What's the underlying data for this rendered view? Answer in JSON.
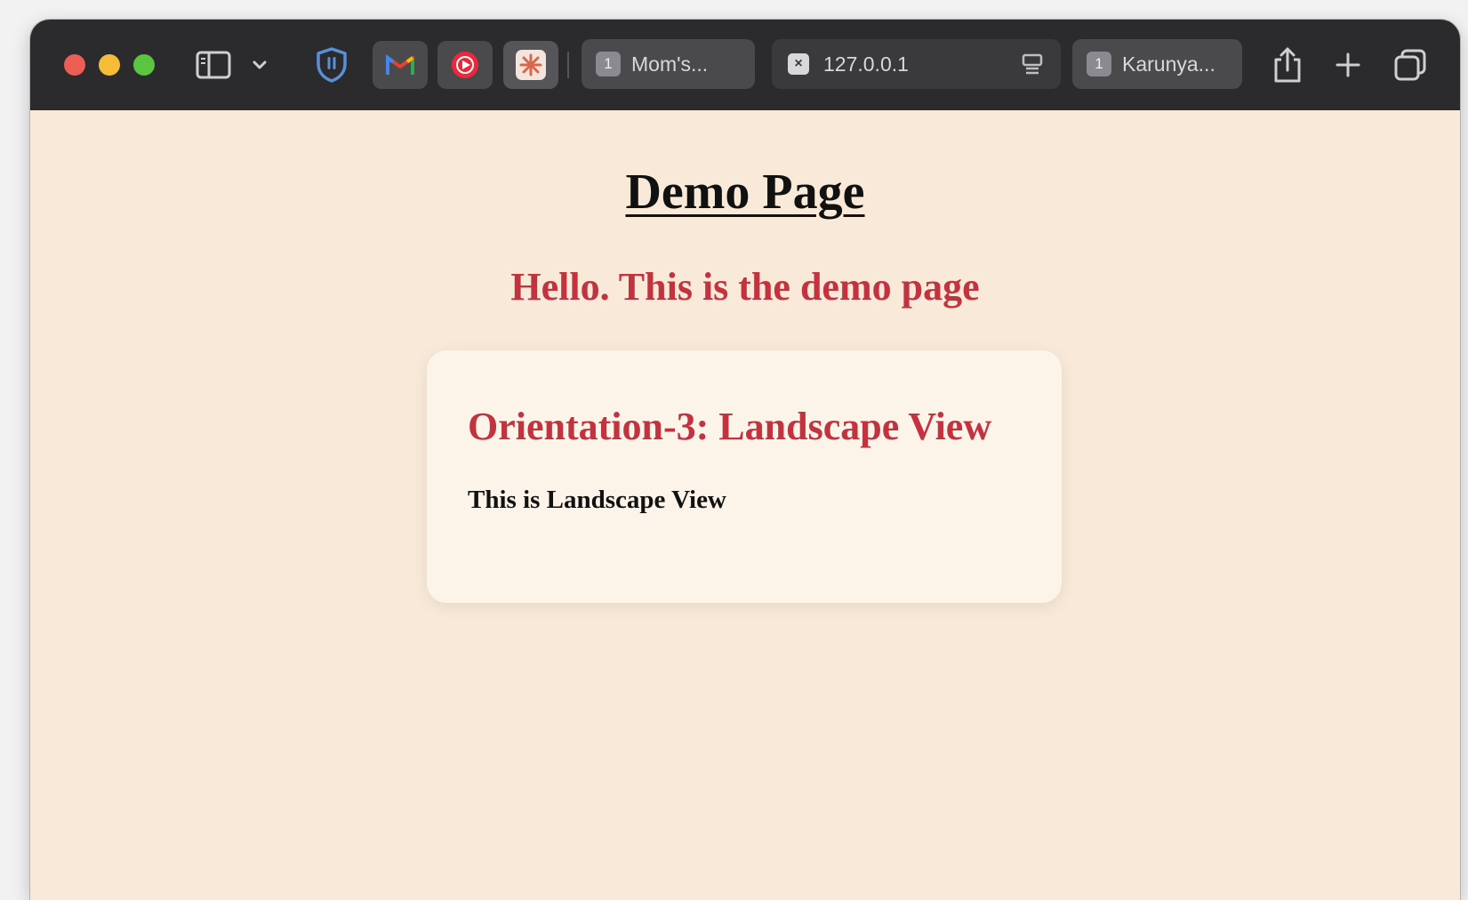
{
  "browser": {
    "tabs": [
      {
        "badge": "1",
        "label": "Mom's..."
      },
      {
        "label": "127.0.0.1",
        "close_glyph": "×"
      },
      {
        "badge": "1",
        "label": "Karunya..."
      }
    ],
    "icons": [
      "sidebar-icon",
      "chevron-down-icon",
      "shield-icon",
      "gmail-icon",
      "youtube-music-icon",
      "claude-icon",
      "reader-icon",
      "share-icon",
      "plus-icon",
      "tabs-overview-icon"
    ]
  },
  "page": {
    "title": "Demo Page",
    "greeting": "Hello. This is the demo page",
    "card": {
      "heading": "Orientation-3: Landscape View",
      "text": "This is Landscape View"
    }
  },
  "colors": {
    "page_background": "#f8e9d8",
    "card_background": "#fcf3e9",
    "accent_red": "#c2333f",
    "toolbar": "#2b2b2d"
  }
}
